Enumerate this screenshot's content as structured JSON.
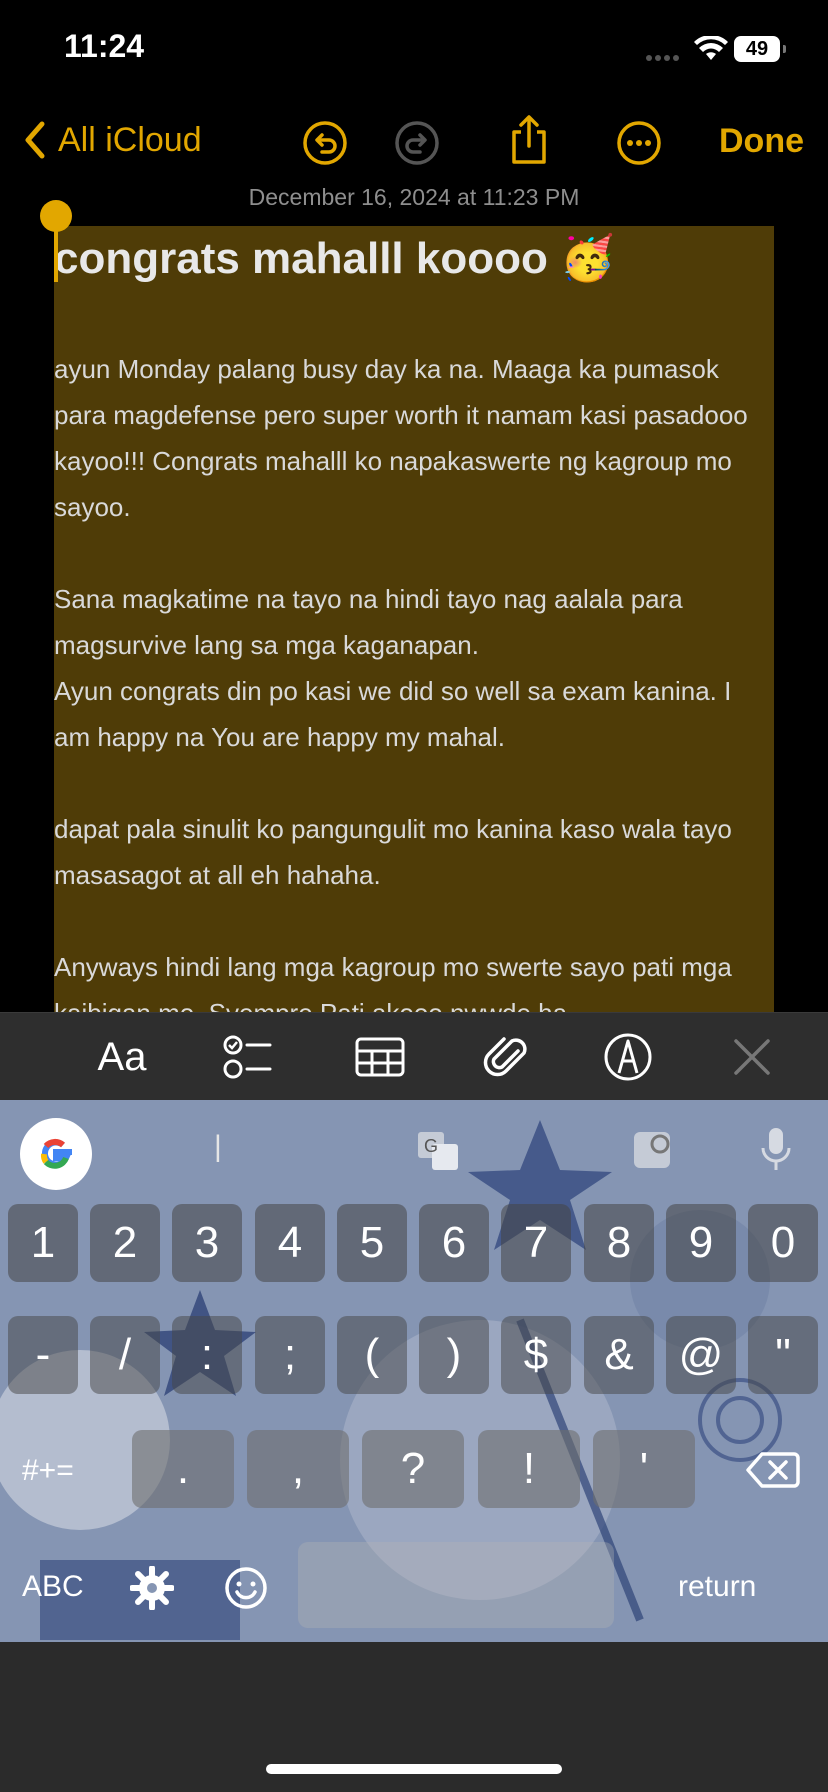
{
  "status": {
    "time": "11:24",
    "battery": "49"
  },
  "nav": {
    "back_label": "All iCloud",
    "done_label": "Done"
  },
  "note": {
    "date": "December 16, 2024 at 11:23 PM",
    "title": "congrats mahalll koooo 🥳",
    "paragraphs": [
      "ayun Monday palang busy day ka na. Maaga ka pumasok para magdefense pero super worth it namam kasi pasadooo kayoo!!! Congrats mahalll ko napakaswerte ng kagroup mo sayoo.",
      "Sana magkatime na tayo na hindi tayo nag aalala para magsurvive lang sa mga kaganapan.\nAyun congrats din po kasi we did so well sa exam kanina. I am happy na You are happy my mahal.",
      "dapat pala sinulit ko pangungulit mo kanina kaso wala tayo masasagot at all eh hahaha.",
      "Anyways hindi lang mga kagroup mo swerte sayo pati mga kaibigan mo. Syempre Pati akooo nwwde ha"
    ]
  },
  "format_bar": {
    "aa_label": "Aa"
  },
  "keyboard": {
    "row1": [
      "1",
      "2",
      "3",
      "4",
      "5",
      "6",
      "7",
      "8",
      "9",
      "0"
    ],
    "row2": [
      "-",
      "/",
      ":",
      ";",
      "(",
      ")",
      "$",
      "&",
      "@",
      "\""
    ],
    "row3": [
      ".",
      ",",
      "?",
      "!",
      "'"
    ],
    "symbols_label": "#+=",
    "abc_label": "ABC",
    "return_label": "return",
    "suggestion_cursor": "|"
  }
}
